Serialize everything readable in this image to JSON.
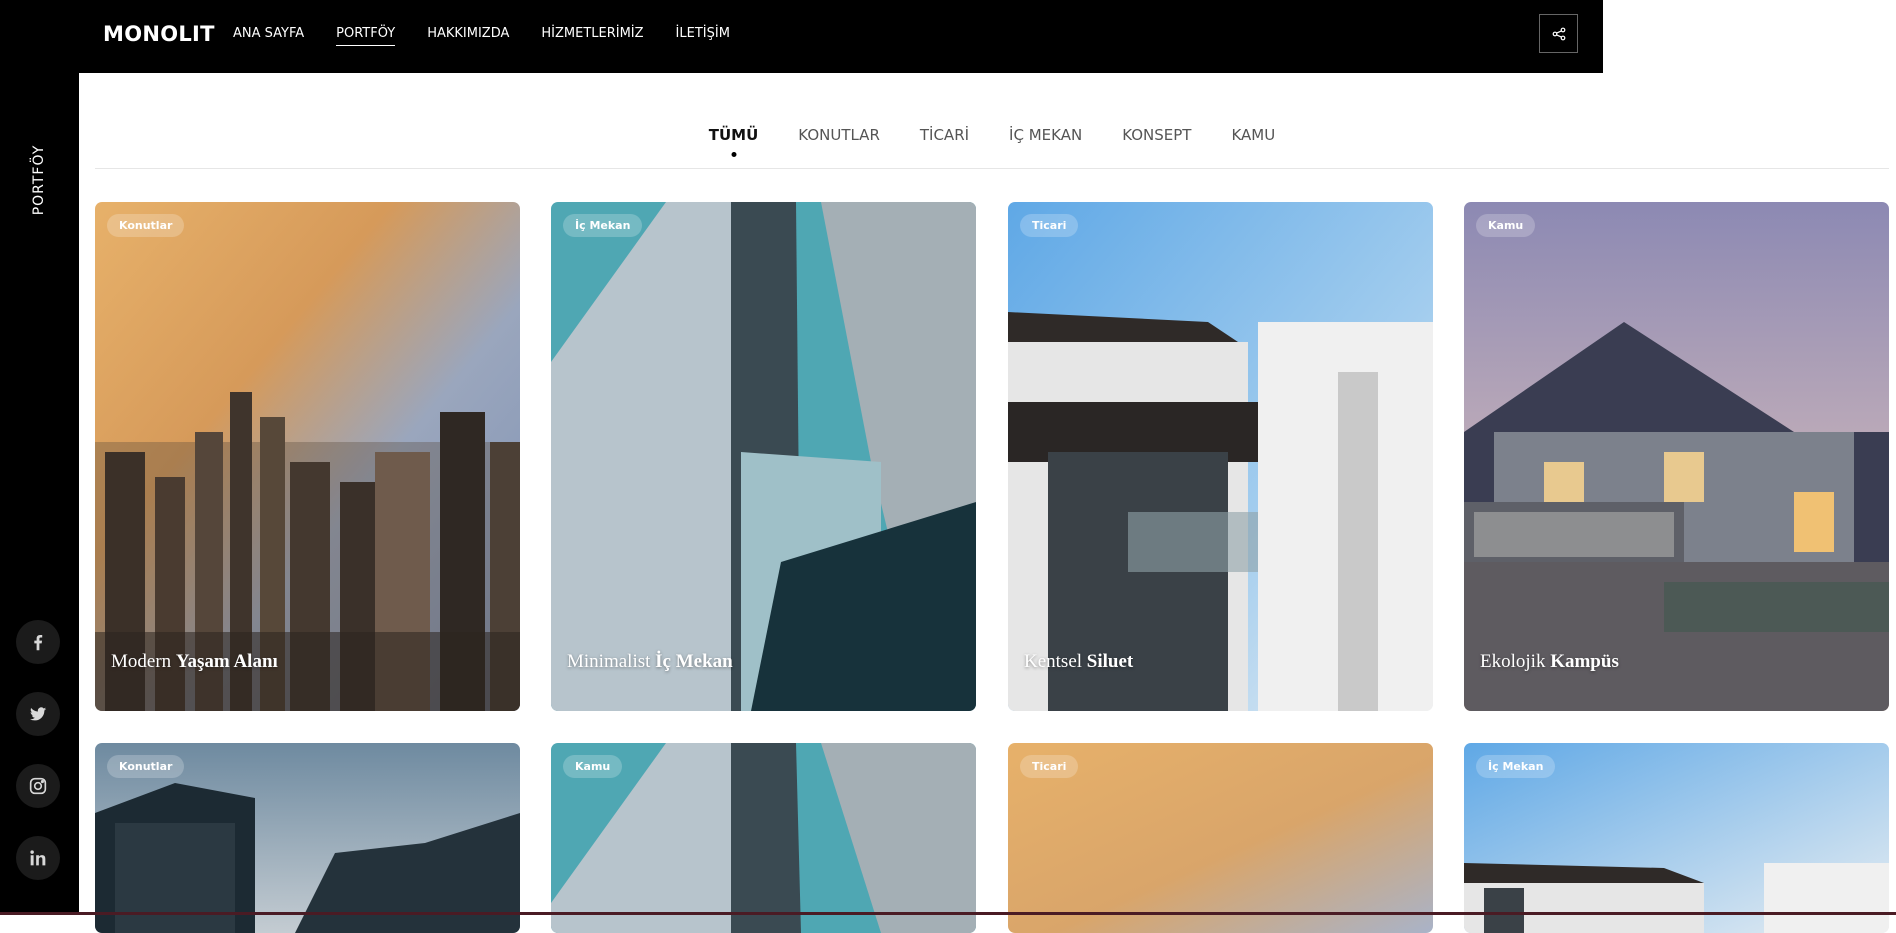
{
  "brand": {
    "logo": "MONOLIT"
  },
  "nav": {
    "items": [
      "ANA SAYFA",
      "PORTFÖY",
      "HAKKIMIZDA",
      "HİZMETLERİMİZ",
      "İLETİŞİM"
    ],
    "active": "PORTFÖY",
    "share_icon": "share-icon"
  },
  "sidebar": {
    "label": "PORTFÖY",
    "socials": [
      "facebook-icon",
      "twitter-icon",
      "instagram-icon",
      "linkedin-icon"
    ]
  },
  "filters": {
    "items": [
      "TÜMÜ",
      "KONUTLAR",
      "TİCARİ",
      "İÇ MEKAN",
      "KONSEPT",
      "KAMU"
    ],
    "active": "TÜMÜ"
  },
  "portfolio": [
    {
      "badge": "Konutlar",
      "title_light": "Modern",
      "title_bold": "Yaşam Alanı"
    },
    {
      "badge": "İç Mekan",
      "title_light": "Minimalist",
      "title_bold": "İç Mekan"
    },
    {
      "badge": "Ticari",
      "title_light": "Kentsel",
      "title_bold": "Siluet"
    },
    {
      "badge": "Kamu",
      "title_light": "Ekolojik",
      "title_bold": "Kampüs"
    },
    {
      "badge": "Konutlar",
      "title_light": "",
      "title_bold": ""
    },
    {
      "badge": "Kamu",
      "title_light": "",
      "title_bold": ""
    },
    {
      "badge": "Ticari",
      "title_light": "",
      "title_bold": ""
    },
    {
      "badge": "İç Mekan",
      "title_light": "",
      "title_bold": ""
    }
  ]
}
